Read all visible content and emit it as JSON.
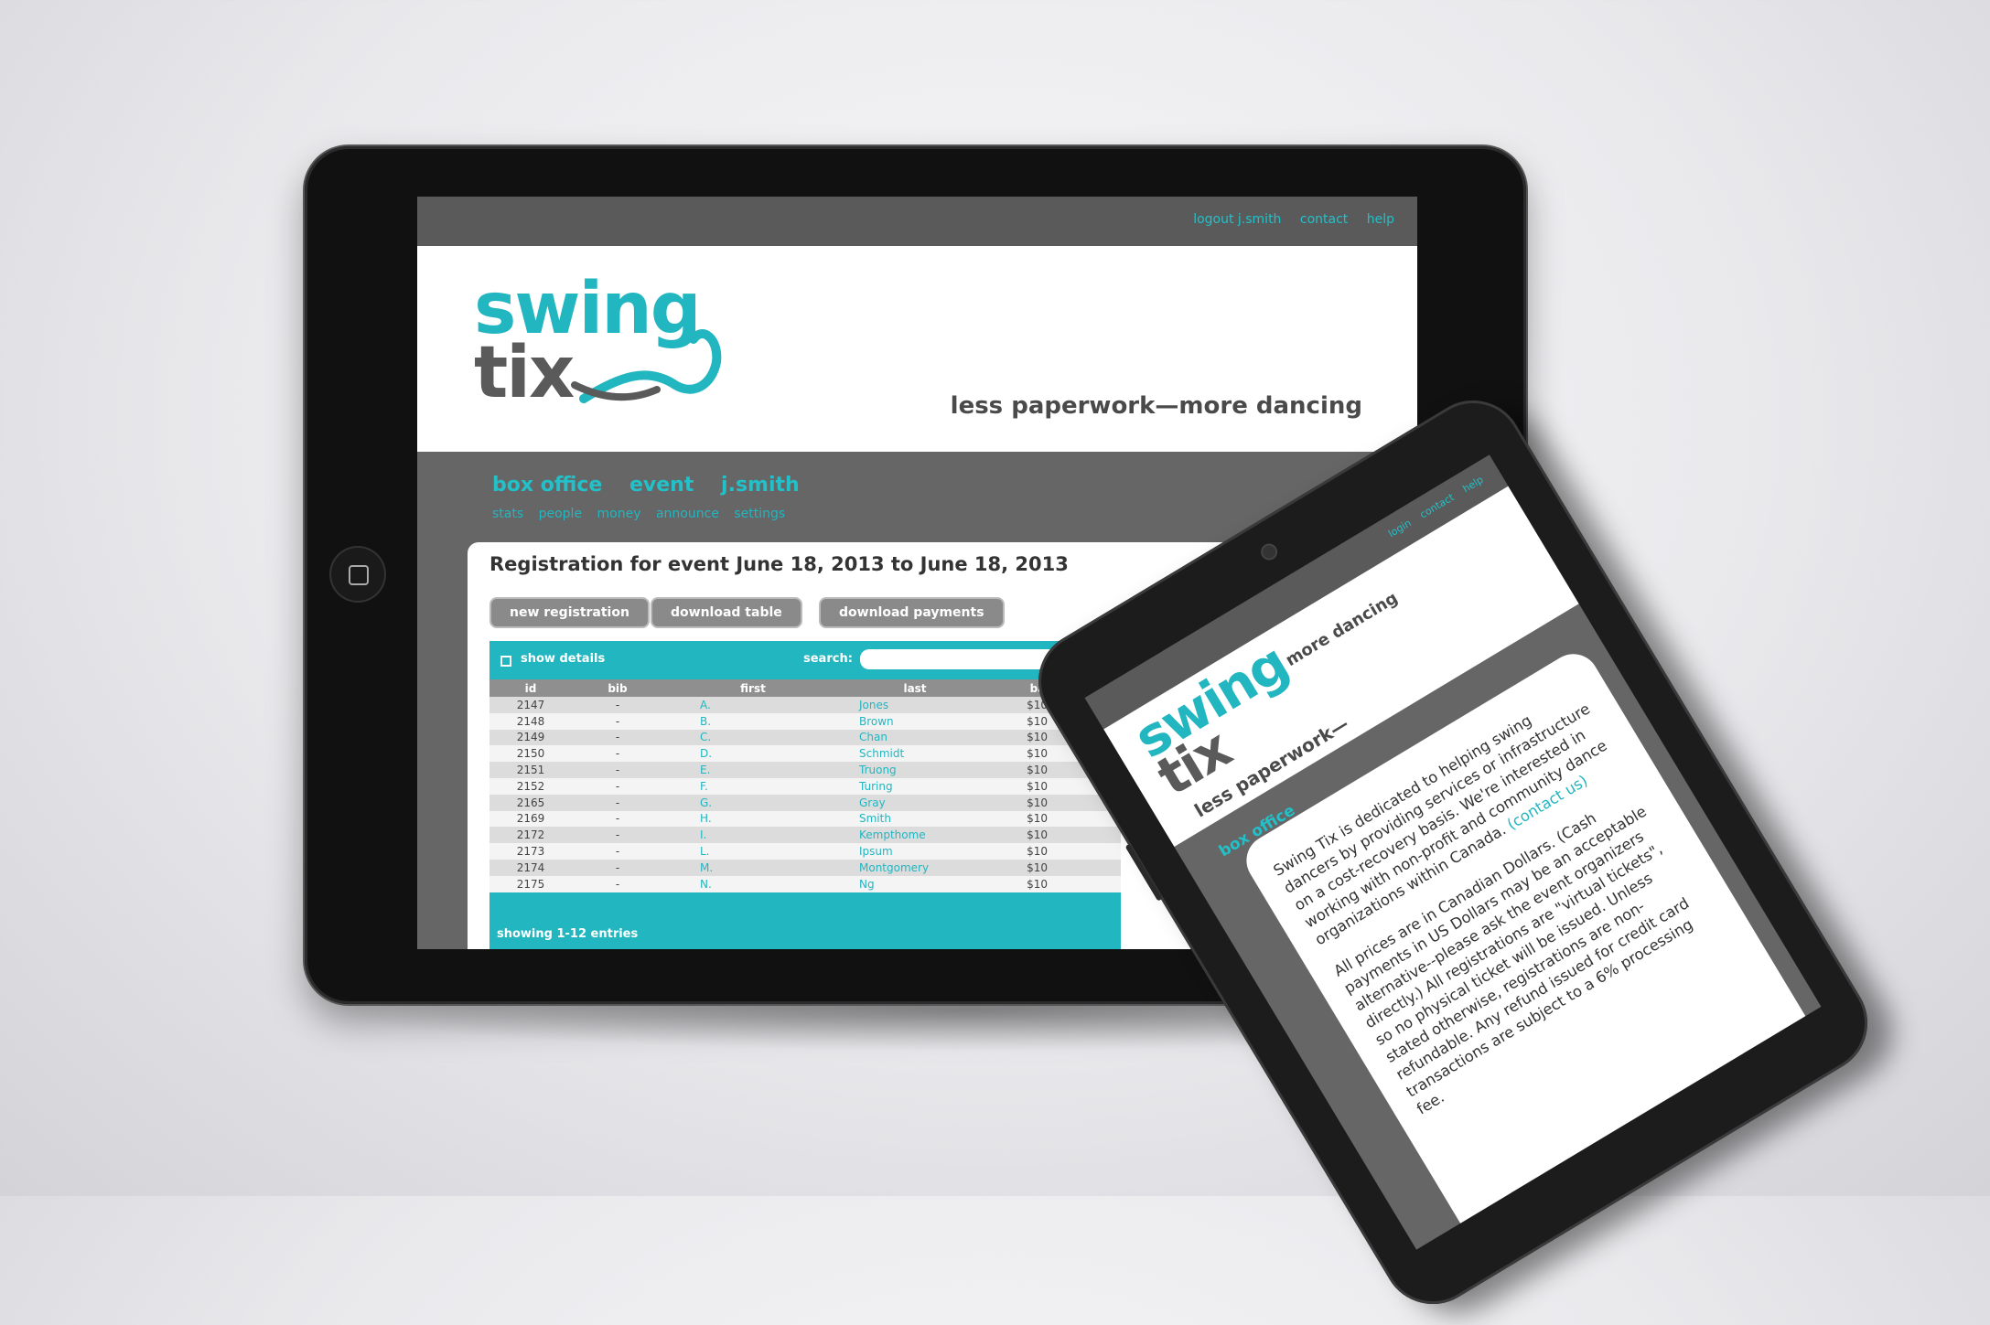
{
  "tablet": {
    "toplinks": [
      "logout j.smith",
      "contact",
      "help"
    ],
    "logo_line1": "swing",
    "logo_line2": "tix",
    "tagline": "less paperwork—more dancing",
    "nav_main": [
      "box office",
      "event",
      "j.smith"
    ],
    "nav_sub": [
      "stats",
      "people",
      "money",
      "announce",
      "settings"
    ],
    "panel_title": "Registration for event June 18, 2013 to June 18, 2013",
    "buttons": {
      "new_registration": "new registration",
      "download_table": "download table",
      "download_payments": "download payments"
    },
    "show_details": "show details",
    "search_label": "search:",
    "table": {
      "headers": [
        "id",
        "bib",
        "first",
        "last",
        "balance"
      ],
      "rows": [
        {
          "id": "2147",
          "bib": "-",
          "first": "A.",
          "last": "Jones",
          "balance": "$10"
        },
        {
          "id": "2148",
          "bib": "-",
          "first": "B.",
          "last": "Brown",
          "balance": "$10"
        },
        {
          "id": "2149",
          "bib": "-",
          "first": "C.",
          "last": "Chan",
          "balance": "$10"
        },
        {
          "id": "2150",
          "bib": "-",
          "first": "D.",
          "last": "Schmidt",
          "balance": "$10"
        },
        {
          "id": "2151",
          "bib": "-",
          "first": "E.",
          "last": "Truong",
          "balance": "$10"
        },
        {
          "id": "2152",
          "bib": "-",
          "first": "F.",
          "last": "Turing",
          "balance": "$10"
        },
        {
          "id": "2165",
          "bib": "-",
          "first": "G.",
          "last": "Gray",
          "balance": "$10"
        },
        {
          "id": "2169",
          "bib": "-",
          "first": "H.",
          "last": "Smith",
          "balance": "$10"
        },
        {
          "id": "2172",
          "bib": "-",
          "first": "I.",
          "last": "Kempthome",
          "balance": "$10"
        },
        {
          "id": "2173",
          "bib": "-",
          "first": "L.",
          "last": "Ipsum",
          "balance": "$10"
        },
        {
          "id": "2174",
          "bib": "-",
          "first": "M.",
          "last": "Montgomery",
          "balance": "$10"
        },
        {
          "id": "2175",
          "bib": "-",
          "first": "N.",
          "last": "Ng",
          "balance": "$10"
        }
      ]
    },
    "footer": "showing 1-12 entries"
  },
  "phone": {
    "toplinks": [
      "login",
      "contact",
      "help"
    ],
    "logo_line1": "swing",
    "logo_line2": "tix",
    "tagline_left": "less paperwork—",
    "tagline_right": "more dancing",
    "nav": "box office",
    "para1": "Swing Tix is dedicated to helping swing dancers by providing services or infrastructure on a cost-recovery basis. We're interested in working with non-profit and community dance organizations within Canada.",
    "contact_link": "(contact us)",
    "para2": "All prices are in Canadian Dollars. (Cash payments in US Dollars may be an acceptable alternative--please ask the event organizers directly.) All registrations are \"virtual tickets\", so no physical ticket will be issued. Unless stated otherwise, registrations are non-refundable. Any refund issued for credit card transactions are subject to a 6% processing fee."
  },
  "colors": {
    "accent": "#22b6c0",
    "dark_gray": "#5a5a5a",
    "mid_gray": "#666666"
  }
}
